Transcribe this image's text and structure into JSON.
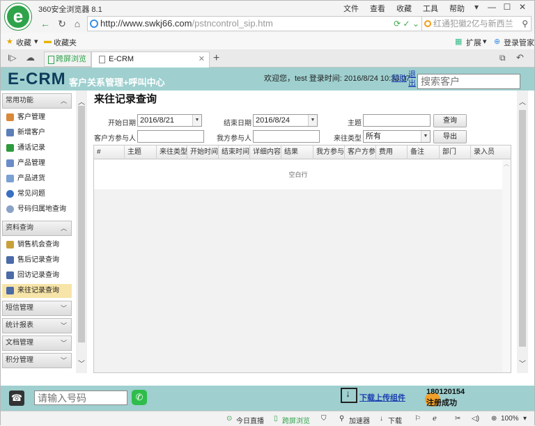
{
  "browser": {
    "title": "360安全浏览器 8.1",
    "menu": [
      "文件",
      "查看",
      "收藏",
      "工具",
      "帮助"
    ],
    "url_host": "http://www.swkj66.com",
    "url_path": "/pstncontrol_sip.htm",
    "search_text": "红通犯徽2亿与新西兰",
    "fav_items": [
      "收藏",
      "收藏夹"
    ],
    "fav_right": [
      "扩展",
      "登录管家"
    ],
    "tabs": [
      {
        "label": "跨屏浏览"
      },
      {
        "label": "E-CRM"
      }
    ]
  },
  "header": {
    "brand": "E-CRM",
    "subtitle": "客户关系管理+呼叫中心",
    "welcome": "欢迎您，test 登录时间: 2016/8/24 10:33:07",
    "help": "帮助",
    "exit": "退出",
    "search_placeholder": "搜索客户"
  },
  "sidebar": {
    "group1": "常用功能",
    "items1": [
      "客户管理",
      "新增客户",
      "通话记录",
      "产品管理",
      "产品进货",
      "常见问题",
      "号码归属地查询"
    ],
    "group2": "资料查询",
    "items2": [
      "销售机会查询",
      "售后记录查询",
      "回访记录查询",
      "来往记录查询"
    ],
    "groups_more": [
      "短信管理",
      "统计报表",
      "文档管理",
      "积分管理"
    ]
  },
  "page": {
    "title": "来往记录查询",
    "start_label": "开始日期",
    "start_value": "2016/8/21",
    "end_label": "结束日期",
    "end_value": "2016/8/24",
    "subject_label": "主题",
    "subject_value": "",
    "query_btn": "查询",
    "cust_part_label": "客户方参与人",
    "our_part_label": "我方参与人",
    "type_label": "来往类型",
    "type_value": "所有",
    "export_btn": "导出"
  },
  "table": {
    "columns": [
      "#",
      "主题",
      "来往类型",
      "开始时间",
      "结束时间",
      "详细内容",
      "结果",
      "我方参与人",
      "客户方参与人",
      "费用",
      "备注",
      "部门",
      "录入员"
    ],
    "empty_text": "空白行"
  },
  "footer": {
    "dial_placeholder": "请输入号码",
    "download_label": "下载上传组件",
    "number": "180120154",
    "status": "注册成功"
  },
  "statusbar": {
    "items": [
      "今日直播",
      "跨屏浏览",
      "加速器",
      "下载"
    ],
    "zoom": "100%"
  },
  "colors": {
    "header_bg": "#9fcfcf",
    "brand": "#0d3d5a",
    "link": "#1a3fb0",
    "active_item": "#f7e4a8"
  }
}
